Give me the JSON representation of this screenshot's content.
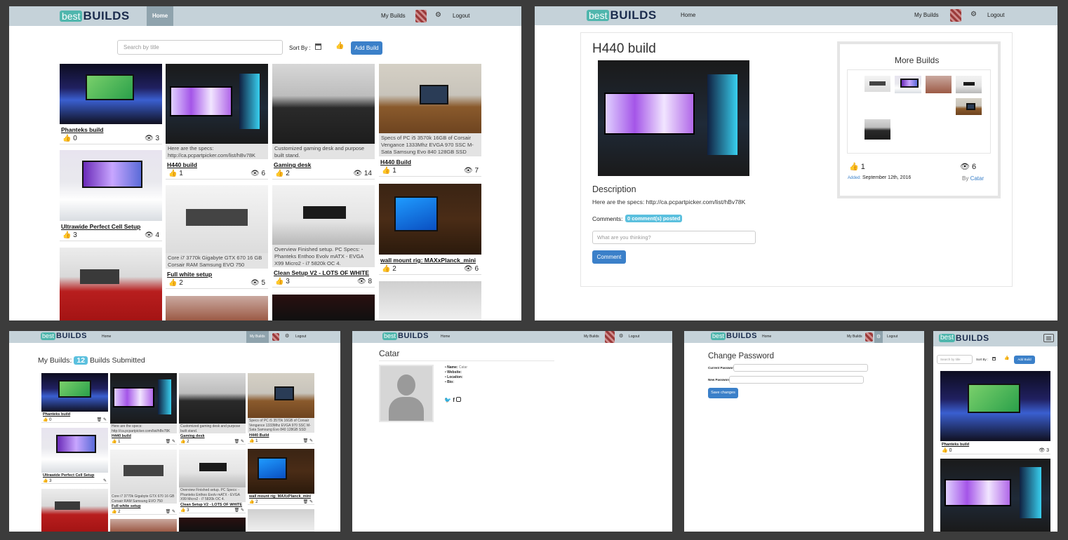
{
  "logo": {
    "best": "best",
    "builds": "BUILDS"
  },
  "nav": {
    "home": "Home",
    "my_builds": "My Builds",
    "logout": "Logout",
    "gear": "⚙"
  },
  "search": {
    "placeholder": "Search by title",
    "sort_label": "Sort By :",
    "add_build": "Add Build"
  },
  "cards": [
    {
      "title": "Phanteks build",
      "likes": "0",
      "views": "3",
      "desc": ""
    },
    {
      "title": "H440 build",
      "likes": "1",
      "views": "6",
      "desc": "Here are the specs: http://ca.pcpartpicker.com/list/hBv78K"
    },
    {
      "title": "Gaming desk",
      "likes": "2",
      "views": "14",
      "desc": "Customized gaming desk and purpose built stand."
    },
    {
      "title": "H440 Build",
      "likes": "1",
      "views": "7",
      "desc": "Specs of PC i5 3570k 16GB of Corsair Vengance 1333Mhz EVGA 970 SSC M-Sata Samsung Evo 840 128GB SSD"
    },
    {
      "title": "Ultrawide Perfect Cell Setup",
      "likes": "3",
      "views": "4",
      "desc": ""
    },
    {
      "title": "Full white setup",
      "likes": "2",
      "views": "5",
      "desc": "Core i7 3770k Gigabyte GTX 670 16 GB Corsair RAM Samsung EVO 750"
    },
    {
      "title": "Clean Setup V2 - LOTS OF WHITE",
      "likes": "3",
      "views": "8",
      "desc": "Overview Finished setup. PC Specs: - Phanteks Enthoo Evolv mATX - EVGA X99 Micro2 - i7 5820k OC 4."
    },
    {
      "title": "wall mount rig: MAXxPlanck_mini",
      "likes": "2",
      "views": "6",
      "desc": ""
    }
  ],
  "detail": {
    "title": "H440 build",
    "description_heading": "Description",
    "description": "Here are the specs: http://ca.pcpartpicker.com/list/hBv78K",
    "comments_label": "Comments:",
    "comments_badge": "0 comment(s) posted",
    "comment_placeholder": "What are you thinking?",
    "comment_button": "Comment",
    "more_builds": "More Builds",
    "likes": "1",
    "views": "6",
    "added_label": "Added:",
    "added_date": "September 12th, 2016",
    "by_label": "By",
    "author": "Catar"
  },
  "mybuilds": {
    "label": "My Builds:",
    "count": "12",
    "suffix": "Builds Submitted"
  },
  "profile": {
    "name": "Catar",
    "fields": [
      {
        "label": "Name:",
        "value": "Catar"
      },
      {
        "label": "Website:",
        "value": ""
      },
      {
        "label": "Location:",
        "value": ""
      },
      {
        "label": "Bio:",
        "value": ""
      }
    ]
  },
  "password": {
    "title": "Change Password",
    "current_label": "Current Password",
    "new_label": "New Password",
    "save": "Save changes"
  },
  "colors": {
    "nav": "#c5d2d9",
    "accent": "#4fb6ad",
    "primary": "#3b80c9",
    "badge": "#5bc0de"
  }
}
